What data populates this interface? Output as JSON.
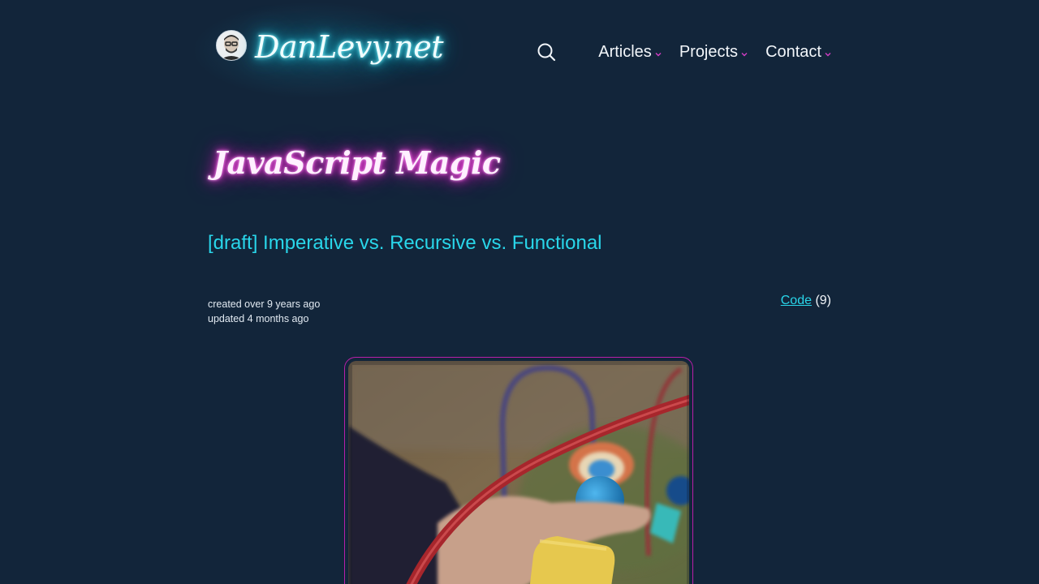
{
  "header": {
    "brand": "DanLevy.net",
    "nav": [
      {
        "label": "Articles"
      },
      {
        "label": "Projects"
      },
      {
        "label": "Contact"
      }
    ]
  },
  "category": "JavaScript Magic",
  "article": {
    "title": "[draft] Imperative vs. Recursive vs. Functional",
    "created": "created over 9 years ago",
    "updated": "updated 4 months ago",
    "tag": {
      "label": "Code",
      "count": "(9)"
    }
  },
  "colors": {
    "background": "#12253a",
    "accent_cyan": "#29d6ea",
    "accent_magenta": "#c51fb4"
  },
  "icons": [
    "search-icon",
    "chevron-down-icon"
  ]
}
